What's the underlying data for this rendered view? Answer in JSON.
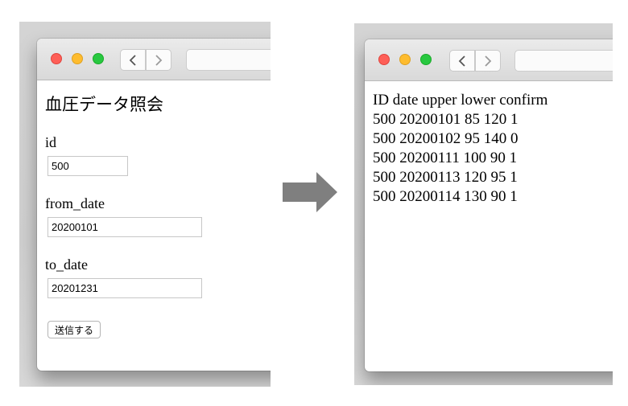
{
  "form_screen": {
    "title": "血圧データ照会",
    "fields": [
      {
        "label": "id",
        "value": "500"
      },
      {
        "label": "from_date",
        "value": "20200101"
      },
      {
        "label": "to_date",
        "value": "20201231"
      }
    ],
    "submit_label": "送信する"
  },
  "result_screen": {
    "lines": [
      "ID date upper lower confirm",
      "500 20200101 85 120 1",
      "500 20200102 95 140 0",
      "500 20200111 100 90 1",
      "500 20200113 120 95 1",
      "500 20200114 130 90 1"
    ]
  },
  "icons": {
    "back": "chevron-left-icon",
    "forward": "chevron-right-icon",
    "flow": "arrow-right-icon"
  },
  "colors": {
    "close": "#fe5f57",
    "minimize": "#febc2e",
    "zoom": "#28c840",
    "arrow": "#7f7f7f"
  }
}
